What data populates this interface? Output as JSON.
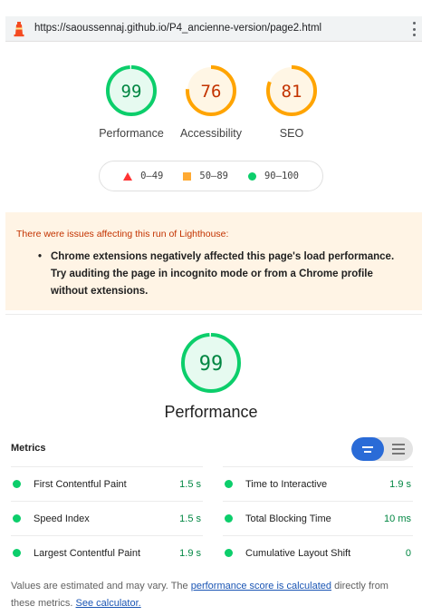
{
  "browser": {
    "url": "https://saoussennaj.github.io/P4_ancienne-version/page2.html",
    "logo_icon": "lighthouse-icon",
    "menu_icon": "kebab-menu-icon"
  },
  "scores": [
    {
      "label": "Performance",
      "value": "99",
      "fraction": 0.99,
      "status": "pass"
    },
    {
      "label": "Accessibility",
      "value": "76",
      "fraction": 0.76,
      "status": "average"
    },
    {
      "label": "SEO",
      "value": "81",
      "fraction": 0.81,
      "status": "average"
    }
  ],
  "legend": {
    "fail": "0–49",
    "average": "50–89",
    "pass": "90–100"
  },
  "warning": {
    "title": "There were issues affecting this run of Lighthouse:",
    "item": "Chrome extensions negatively affected this page's load performance. Try auditing the page in incognito mode or from a Chrome profile without extensions."
  },
  "performance": {
    "value": "99",
    "fraction": 0.99,
    "title": "Performance"
  },
  "metrics": {
    "title": "Metrics",
    "items": [
      {
        "name": "First Contentful Paint",
        "value": "1.5 s"
      },
      {
        "name": "Time to Interactive",
        "value": "1.9 s"
      },
      {
        "name": "Speed Index",
        "value": "1.5 s"
      },
      {
        "name": "Total Blocking Time",
        "value": "10 ms"
      },
      {
        "name": "Largest Contentful Paint",
        "value": "1.9 s"
      },
      {
        "name": "Cumulative Layout Shift",
        "value": "0"
      }
    ]
  },
  "footnote": {
    "prefix": "Values are estimated and may vary. The ",
    "link1": "performance score is calculated",
    "middle": " directly from these metrics. ",
    "link2": "See calculator."
  },
  "colors": {
    "pass": "#0cce6b",
    "pass_text": "#018642",
    "average": "#ffa400",
    "average_text": "#c33300",
    "fail": "#ff3333",
    "accent": "#2a6bd7"
  }
}
